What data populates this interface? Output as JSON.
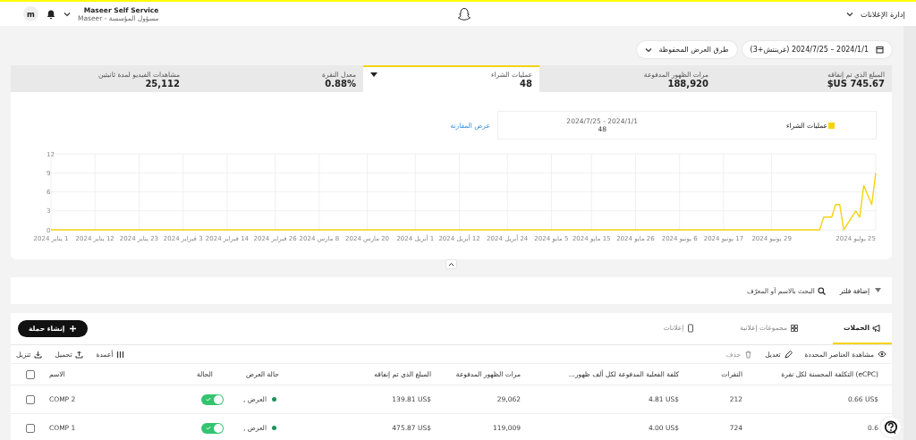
{
  "top_bar": {
    "menu_title": "إدارة الإعلانات",
    "account_name": "Maseer Self Service",
    "account_role": "مسؤول المؤسسة - Maseer",
    "avatar": "m"
  },
  "date_range": "2024/1/1 – 2024/7/25 (غرينتش+3)",
  "saved_views": "طرق العرض المحفوظة",
  "metrics": [
    {
      "label": "المبلغ الذي تم إنفاقه",
      "value": "$US 745.67",
      "selected": false
    },
    {
      "label": "مرات الظهور المدفوعة",
      "value": "188,920",
      "selected": false
    },
    {
      "label": "عمليات الشراء",
      "value": "48",
      "selected": true
    },
    {
      "label": "معدل النقرة",
      "value": "0.88%",
      "selected": false
    },
    {
      "label": "مشاهدات الفيديو لمدة ثانيتين",
      "value": "25,112",
      "selected": false
    }
  ],
  "chart": {
    "range": "2024/1/1 - 2024/7/25",
    "total": "48",
    "compare_link": "عرض المقارنة",
    "chart_data": {
      "type": "line",
      "grid": true,
      "xlim": [
        "2024-01-01",
        "2024-07-25"
      ],
      "ylim": [
        0,
        12
      ],
      "yticks": [
        0,
        3,
        6,
        9,
        12
      ],
      "xticks": [
        {
          "value": "2024-01-01",
          "label": "1 يناير 2024"
        },
        {
          "value": "2024-01-12",
          "label": "12 يناير 2024"
        },
        {
          "value": "2024-01-23",
          "label": "23 يناير 2024"
        },
        {
          "value": "2024-02-03",
          "label": "3 فبراير 2024"
        },
        {
          "value": "2024-02-14",
          "label": "14 فبراير 2024"
        },
        {
          "value": "2024-02-26",
          "label": "26 فبراير 2024"
        },
        {
          "value": "2024-03-08",
          "label": "8 مارس 2024"
        },
        {
          "value": "2024-03-20",
          "label": "20 مارس 2024"
        },
        {
          "value": "2024-04-01",
          "label": "1 أبريل 2024"
        },
        {
          "value": "2024-04-12",
          "label": "12 أبريل 2024"
        },
        {
          "value": "2024-04-24",
          "label": "24 أبريل 2024"
        },
        {
          "value": "2024-05-05",
          "label": "5 مايو 2024"
        },
        {
          "value": "2024-05-15",
          "label": "15 مايو 2024"
        },
        {
          "value": "2024-05-26",
          "label": "26 مايو 2024"
        },
        {
          "value": "2024-06-06",
          "label": "6 يونيو 2024"
        },
        {
          "value": "2024-06-17",
          "label": "17 يونيو 2024"
        },
        {
          "value": "2024-06-29",
          "label": "29 يونيو 2024"
        },
        {
          "value": "2024-07-25",
          "label": "25 يوليو 2024"
        }
      ],
      "x": [
        "2024-01-01",
        "2024-07-11",
        "2024-07-12",
        "2024-07-14",
        "2024-07-15",
        "2024-07-16",
        "2024-07-17",
        "2024-07-20",
        "2024-07-21",
        "2024-07-22",
        "2024-07-24",
        "2024-07-25"
      ],
      "series": [
        {
          "name": "عمليات الشراء",
          "color": "#f5d30f",
          "values": [
            0,
            0,
            2,
            2,
            4,
            4,
            0,
            3,
            2,
            7,
            4,
            9
          ]
        }
      ]
    }
  },
  "filter_bar": {
    "add_filter": "إضافة فلتر",
    "search_placeholder": "البحث بالاسم أو المعرّف"
  },
  "tabs": [
    {
      "label": "الحملات",
      "selected": true
    },
    {
      "label": "مجموعات إعلانية",
      "selected": false
    },
    {
      "label": "إعلانات",
      "selected": false
    }
  ],
  "create_button": "إنشاء حملة",
  "actions": [
    {
      "label": "مشاهدة العناصر المحددة",
      "disabled": false
    },
    {
      "label": "تعديل",
      "disabled": false
    },
    {
      "label": "حذف",
      "disabled": true
    }
  ],
  "tools": [
    "أعمدة",
    "تحميل",
    "تنزيل"
  ],
  "table": {
    "select_all_checked": false,
    "columns": [
      "(eCPC) التكلفة المحسنة لكل نقرة",
      "النقرات",
      "كلفة الفعلية المدفوعة لكل ألف ظهور...",
      "مرات الظهور المدفوعة",
      "المبلغ الذي تم إنفاقه",
      "حالة العرض",
      "الحالة",
      "الاسم"
    ],
    "rows": [
      {
        "checked": false,
        "ecpc": "0.66 US$",
        "clicks": "212",
        "ecpm": "4.81 US$",
        "impressions": "29,062",
        "spend": "139.81 US$",
        "display_status": "العرض ,",
        "on": true,
        "name": "COMP 2"
      },
      {
        "checked": false,
        "ecpc": "0.6",
        "clicks": "724",
        "ecpm": "4.00 US$",
        "impressions": "119,009",
        "spend": "475.87 US$",
        "display_status": "العرض ,",
        "on": true,
        "name": "COMP 1"
      }
    ]
  }
}
